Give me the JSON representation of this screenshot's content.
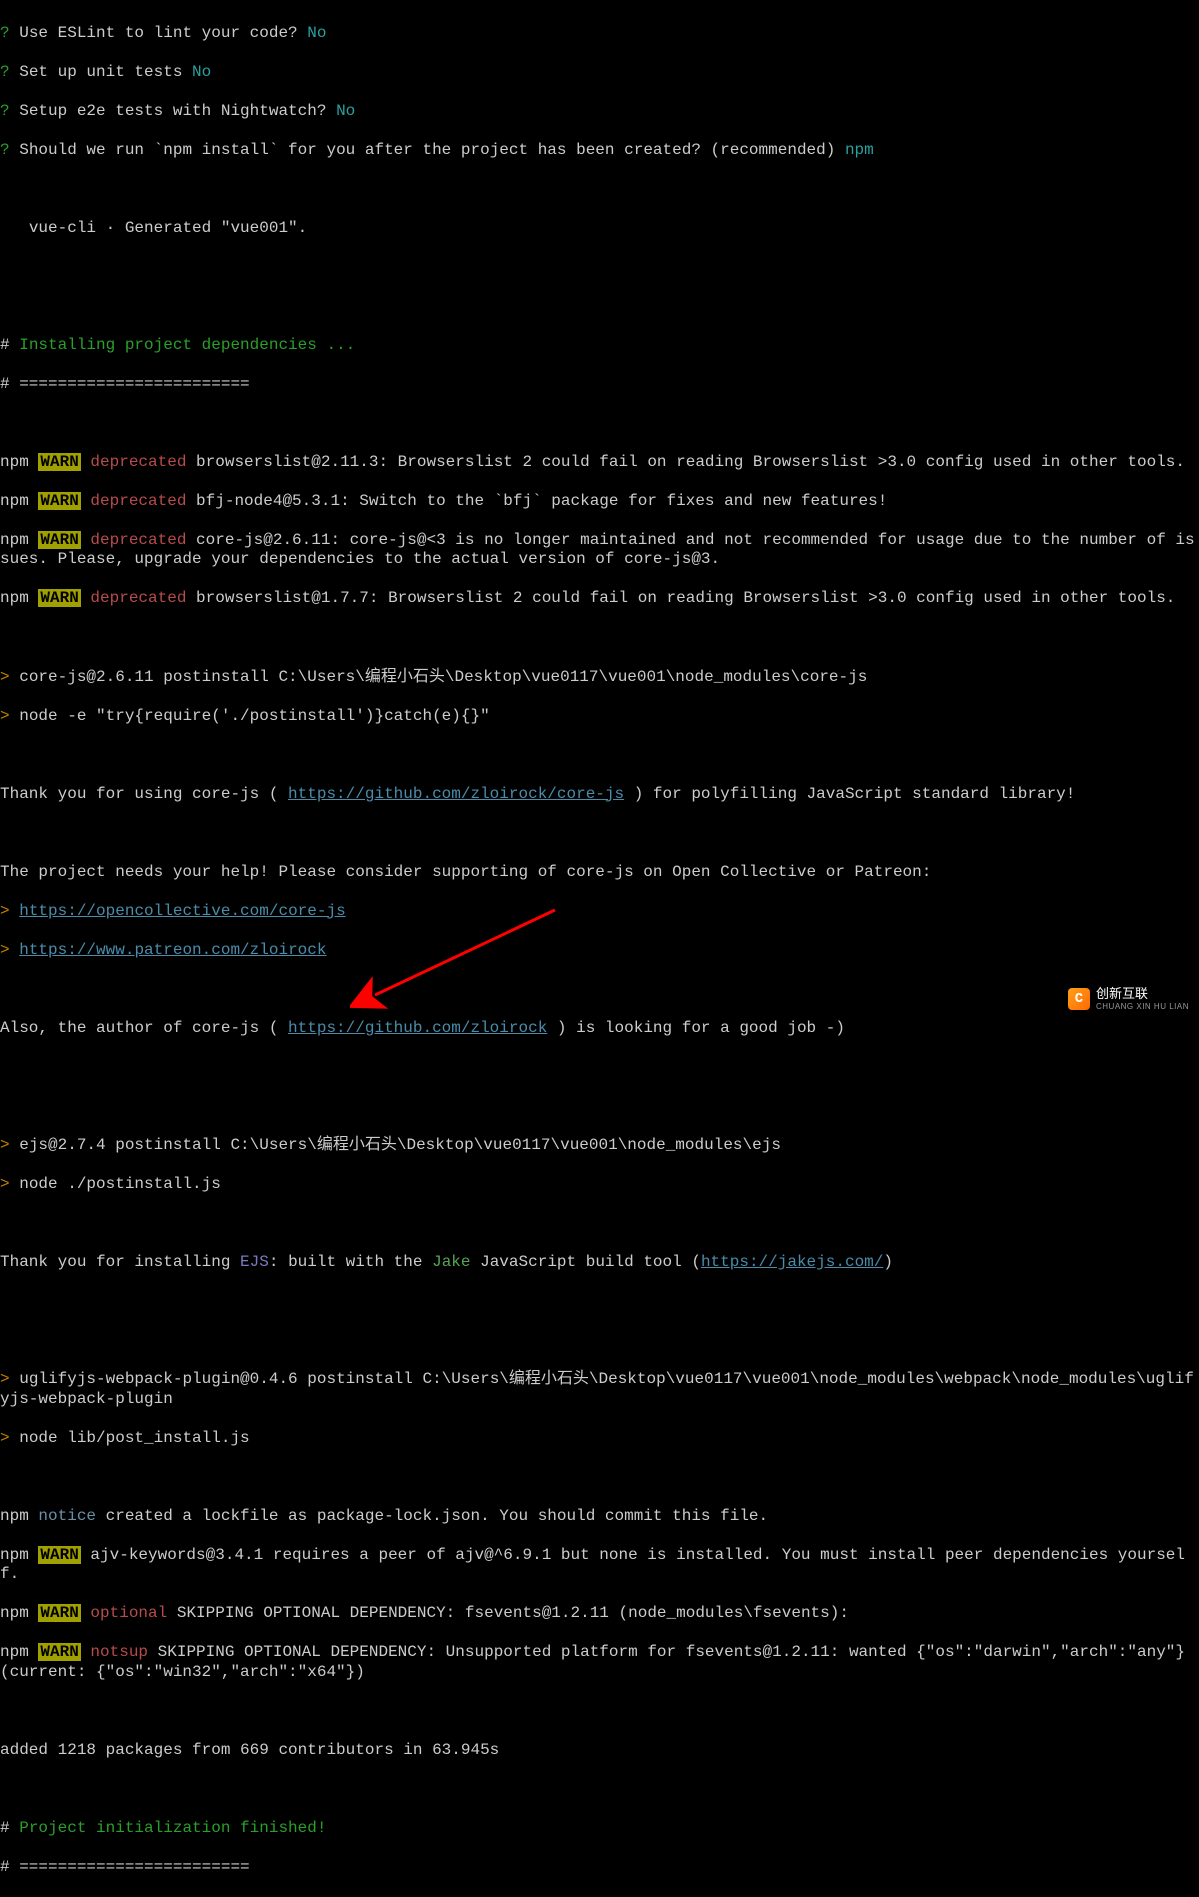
{
  "prompts": {
    "p1": {
      "q": "?",
      "text": " Use ESLint to lint your code? ",
      "ans": "No"
    },
    "p2": {
      "q": "?",
      "text": " Set up unit tests ",
      "ans": "No"
    },
    "p3": {
      "q": "?",
      "text": " Setup e2e tests with Nightwatch? ",
      "ans": "No"
    },
    "p4": {
      "q": "?",
      "text": " Should we run `npm install` for you after the project has been created? (recommended) ",
      "ans": "npm"
    }
  },
  "vuecli": "   vue-cli · Generated \"vue001\".",
  "install_header": {
    "hash": "#",
    "text": " Installing project dependencies ..."
  },
  "install_sep": "# ========================",
  "warns": {
    "w1": {
      "npm": "npm ",
      "warn": "WARN",
      "sp": " ",
      "tag": "deprecated",
      "msg": " browserslist@2.11.3: Browserslist 2 could fail on reading Browserslist >3.0 config used in other tools."
    },
    "w2": {
      "npm": "npm ",
      "warn": "WARN",
      "sp": " ",
      "tag": "deprecated",
      "msg": " bfj-node4@5.3.1: Switch to the `bfj` package for fixes and new features!"
    },
    "w3": {
      "npm": "npm ",
      "warn": "WARN",
      "sp": " ",
      "tag": "deprecated",
      "msg": " core-js@2.6.11: core-js@<3 is no longer maintained and not recommended for usage due to the number of issues. Please, upgrade your dependencies to the actual version of core-js@3."
    },
    "w4": {
      "npm": "npm ",
      "warn": "WARN",
      "sp": " ",
      "tag": "deprecated",
      "msg": " browserslist@1.7.7: Browserslist 2 could fail on reading Browserslist >3.0 config used in other tools."
    }
  },
  "postinstall1": {
    "l1": {
      "gt": ">",
      "rest": " core-js@2.6.11 postinstall C:\\Users\\编程小石头\\Desktop\\vue0117\\vue001\\node_modules\\core-js"
    },
    "l2": {
      "gt": ">",
      "rest": " node -e \"try{require('./postinstall')}catch(e){}\""
    }
  },
  "corejs_msg": {
    "pre": "Thank you for using core-js ( ",
    "url1": "https://github.com/zloirock/core-js",
    "post": " ) for polyfilling JavaScript standard library!",
    "need": "The project needs your help! Please consider supporting of core-js on Open Collective or Patreon:",
    "l3gt": ">",
    "l3url": "https://opencollective.com/core-js",
    "l4gt": ">",
    "l4url": "https://www.patreon.com/zloirock",
    "alsoPre": "Also, the author of core-js ( ",
    "alsoUrl": "https://github.com/zloirock",
    "alsoPost": " ) is looking for a good job -)"
  },
  "postinstall2": {
    "l1": {
      "gt": ">",
      "rest": " ejs@2.7.4 postinstall C:\\Users\\编程小石头\\Desktop\\vue0117\\vue001\\node_modules\\ejs"
    },
    "l2": {
      "gt": ">",
      "rest": " node ./postinstall.js"
    }
  },
  "ejs_msg": {
    "pre": "Thank you for installing ",
    "ejs": "EJS",
    "mid": ": built with the ",
    "jake": "Jake",
    "post": " JavaScript build tool (",
    "url": "https://jakejs.com/",
    "close": ")"
  },
  "postinstall3": {
    "l1": {
      "gt": ">",
      "rest": " uglifyjs-webpack-plugin@0.4.6 postinstall C:\\Users\\编程小石头\\Desktop\\vue0117\\vue001\\node_modules\\webpack\\node_modules\\uglifyjs-webpack-plugin"
    },
    "l2": {
      "gt": ">",
      "rest": " node lib/post_install.js"
    }
  },
  "tail": {
    "notice": {
      "npm": "npm ",
      "tag": "notice",
      "msg": " created a lockfile as package-lock.json. You should commit this file."
    },
    "w1": {
      "npm": "npm ",
      "warn": "WARN",
      "msg": " ajv-keywords@3.4.1 requires a peer of ajv@^6.9.1 but none is installed. You must install peer dependencies yourself."
    },
    "w2": {
      "npm": "npm ",
      "warn": "WARN",
      "sp": " ",
      "tag": "optional",
      "msg": " SKIPPING OPTIONAL DEPENDENCY: fsevents@1.2.11 (node_modules\\fsevents):"
    },
    "w3": {
      "npm": "npm ",
      "warn": "WARN",
      "sp": " ",
      "tag": "notsup",
      "msg": " SKIPPING OPTIONAL DEPENDENCY: Unsupported platform for fsevents@1.2.11: wanted {\"os\":\"darwin\",\"arch\":\"any\"} (current: {\"os\":\"win32\",\"arch\":\"x64\"})"
    }
  },
  "added": "added 1218 packages from 669 contributors in 63.945s",
  "finished": {
    "hash": "#",
    "text": " Project initialization finished!"
  },
  "finished_sep": "# ========================",
  "watermark": {
    "brand": "创新互联",
    "sub": "CHUANG XIN HU LIAN",
    "logo": "C"
  }
}
